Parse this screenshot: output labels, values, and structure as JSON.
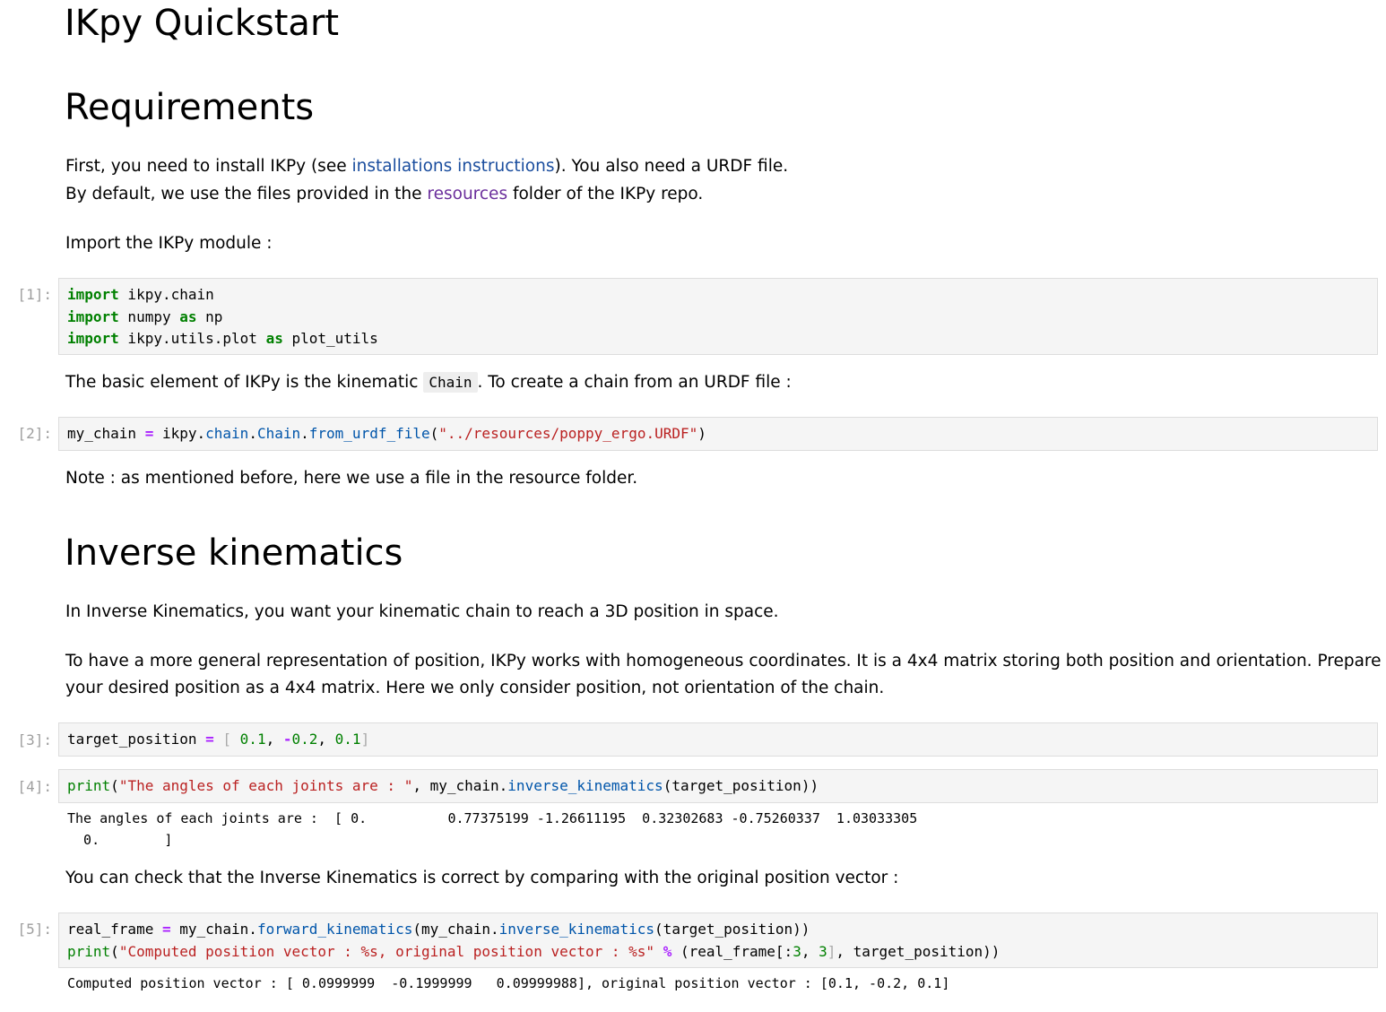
{
  "title": "IKpy Quickstart",
  "requirements": {
    "heading": "Requirements",
    "line1_pre": "First, you need to install IKPy (see ",
    "line1_link": "installations instructions",
    "line1_post": "). You also need a URDF file.",
    "line2_pre": "By default, we use the files provided in the ",
    "line2_link": "resources",
    "line2_post": " folder of the IKPy repo.",
    "import_text": "Import the IKPy module :"
  },
  "cells": [
    {
      "prompt": "[1]:",
      "lines": [
        [
          {
            "t": "import",
            "c": "kw"
          },
          {
            "t": " ikpy.chain",
            "c": ""
          }
        ],
        [
          {
            "t": "import",
            "c": "kw"
          },
          {
            "t": " numpy ",
            "c": ""
          },
          {
            "t": "as",
            "c": "kw"
          },
          {
            "t": " np",
            "c": ""
          }
        ],
        [
          {
            "t": "import",
            "c": "kw"
          },
          {
            "t": " ikpy.utils.plot ",
            "c": ""
          },
          {
            "t": "as",
            "c": "kw"
          },
          {
            "t": " plot_utils",
            "c": ""
          }
        ]
      ]
    },
    {
      "prompt": "[2]:",
      "lines": [
        [
          {
            "t": "my_chain ",
            "c": ""
          },
          {
            "t": "=",
            "c": "op"
          },
          {
            "t": " ikpy.",
            "c": ""
          },
          {
            "t": "chain",
            "c": "attr"
          },
          {
            "t": ".",
            "c": ""
          },
          {
            "t": "Chain",
            "c": "attr"
          },
          {
            "t": ".",
            "c": ""
          },
          {
            "t": "from_urdf_file",
            "c": "attr"
          },
          {
            "t": "(",
            "c": ""
          },
          {
            "t": "\"../resources/poppy_ergo.URDF\"",
            "c": "str"
          },
          {
            "t": ")",
            "c": ""
          }
        ]
      ]
    },
    {
      "prompt": "[3]:",
      "lines": [
        [
          {
            "t": "target_position ",
            "c": ""
          },
          {
            "t": "=",
            "c": "op"
          },
          {
            "t": " [ ",
            "c": "brk"
          },
          {
            "t": "0.1",
            "c": "num"
          },
          {
            "t": ", ",
            "c": ""
          },
          {
            "t": "-",
            "c": "op"
          },
          {
            "t": "0.2",
            "c": "num"
          },
          {
            "t": ", ",
            "c": ""
          },
          {
            "t": "0.1",
            "c": "num"
          },
          {
            "t": "]",
            "c": "brk"
          }
        ]
      ]
    },
    {
      "prompt": "[4]:",
      "lines": [
        [
          {
            "t": "print",
            "c": "fn"
          },
          {
            "t": "(",
            "c": ""
          },
          {
            "t": "\"The angles of each joints are : \"",
            "c": "str"
          },
          {
            "t": ", my_chain.",
            "c": ""
          },
          {
            "t": "inverse_kinematics",
            "c": "attr"
          },
          {
            "t": "(target_position))",
            "c": ""
          }
        ]
      ]
    },
    {
      "prompt": "[5]:",
      "lines": [
        [
          {
            "t": "real_frame ",
            "c": ""
          },
          {
            "t": "=",
            "c": "op"
          },
          {
            "t": " my_chain.",
            "c": ""
          },
          {
            "t": "forward_kinematics",
            "c": "attr"
          },
          {
            "t": "(my_chain.",
            "c": ""
          },
          {
            "t": "inverse_kinematics",
            "c": "attr"
          },
          {
            "t": "(target_position))",
            "c": ""
          }
        ],
        [
          {
            "t": "print",
            "c": "fn"
          },
          {
            "t": "(",
            "c": ""
          },
          {
            "t": "\"Computed position vector : %s, original position vector : %s\"",
            "c": "str"
          },
          {
            "t": " ",
            "c": ""
          },
          {
            "t": "%",
            "c": "op"
          },
          {
            "t": " (real_frame[:",
            "c": ""
          },
          {
            "t": "3",
            "c": "num"
          },
          {
            "t": ", ",
            "c": ""
          },
          {
            "t": "3",
            "c": "num"
          },
          {
            "t": "]",
            "c": "brk"
          },
          {
            "t": ", target_position))",
            "c": ""
          }
        ]
      ]
    }
  ],
  "chain_text": {
    "pre": "The basic element of IKPy is the kinematic ",
    "code": "Chain",
    "post": ". To create a chain from an URDF file :"
  },
  "note_text": "Note : as mentioned before, here we use a file in the resource folder.",
  "inverse": {
    "heading": "Inverse kinematics",
    "para1": "In Inverse Kinematics, you want your kinematic chain to reach a 3D position in space.",
    "para2_line1": "To have a more general representation of position, IKPy works with homogeneous coordinates. It is a 4x4 matrix storing both position and orientation. Prepare",
    "para2_line2": "your desired position as a 4x4 matrix. Here we only consider position, not orientation of the chain."
  },
  "output4": "The angles of each joints are :  [ 0.          0.77375199 -1.26611195  0.32302683 -0.75260337  1.03033305\n  0.        ]",
  "check_text": "You can check that the Inverse Kinematics is correct by comparing with the original position vector :",
  "output5": "Computed position vector : [ 0.0999999  -0.1999999   0.09999988], original position vector : [0.1, -0.2, 0.1]"
}
